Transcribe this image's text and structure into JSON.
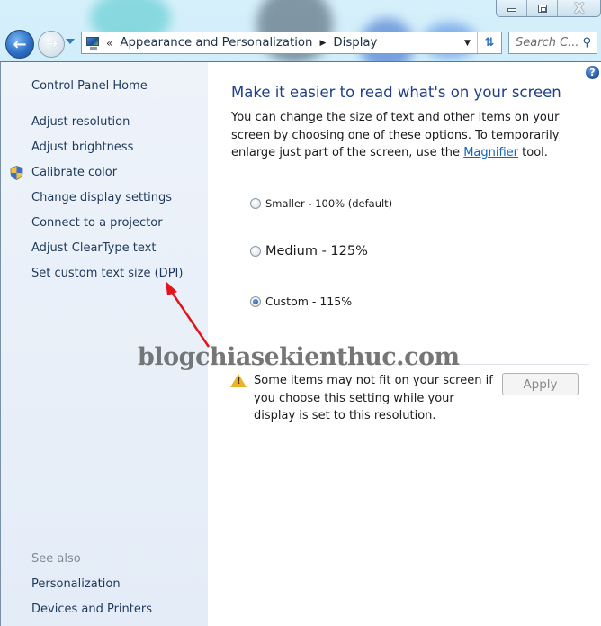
{
  "window": {
    "controls": {
      "minimize": "minimize",
      "maximize": "maximize",
      "close": "X"
    }
  },
  "navigation": {
    "back_icon": "arrow-left-icon",
    "forward_icon": "arrow-right-icon",
    "address": {
      "overflow": "«",
      "breadcrumbs": [
        "Appearance and Personalization",
        "Display"
      ],
      "separator": "▶"
    },
    "search": {
      "placeholder": "Search C..."
    }
  },
  "sidebar": {
    "home": "Control Panel Home",
    "items": [
      {
        "label": "Adjust resolution"
      },
      {
        "label": "Adjust brightness"
      },
      {
        "label": "Calibrate color",
        "icon": "uac-shield-icon"
      },
      {
        "label": "Change display settings"
      },
      {
        "label": "Connect to a projector"
      },
      {
        "label": "Adjust ClearType text"
      },
      {
        "label": "Set custom text size (DPI)"
      }
    ],
    "see_also": {
      "heading": "See also",
      "items": [
        "Personalization",
        "Devices and Printers"
      ]
    }
  },
  "main": {
    "help": "?",
    "title": "Make it easier to read what's on your screen",
    "description_before_link": "You can change the size of text and other items on your screen by choosing one of these options. To temporarily enlarge just part of the screen, use the ",
    "link": "Magnifier",
    "description_after_link": " tool.",
    "options": [
      {
        "label": "Smaller - 100% (default)",
        "checked": false
      },
      {
        "label": "Medium - 125%",
        "checked": false
      },
      {
        "label": "Custom - 115%",
        "checked": true
      }
    ],
    "warning": "Some items may not fit on your screen if you choose this setting while your display is set to this resolution.",
    "apply_label": "Apply"
  },
  "annotation": {
    "watermark": "blogchiasekienthuc.com",
    "arrow_color": "#e0141a"
  }
}
